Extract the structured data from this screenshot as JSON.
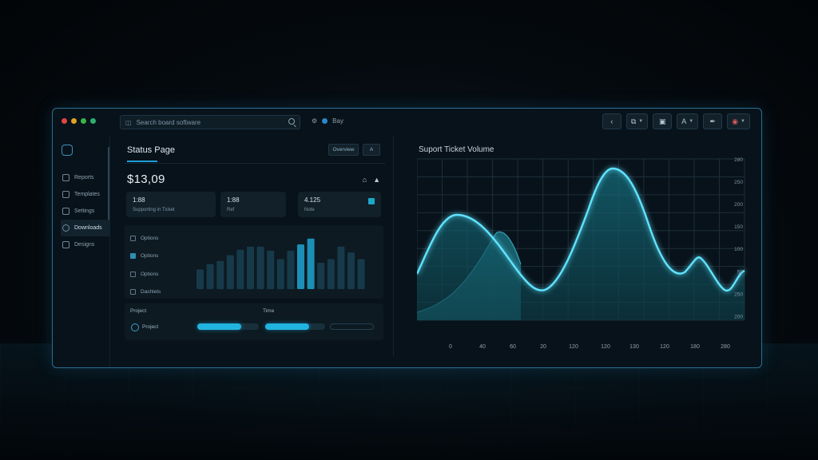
{
  "titlebar": {
    "search_placeholder": "Search board software",
    "location_label": "Bay"
  },
  "sidebar": {
    "items": [
      {
        "label": "Reports",
        "active": false
      },
      {
        "label": "Templates",
        "active": false
      },
      {
        "label": "Settings",
        "active": false
      },
      {
        "label": "Downloads",
        "active": true
      },
      {
        "label": "Designs",
        "active": false
      }
    ]
  },
  "main": {
    "title": "Status Page",
    "header_button_label": "Overview",
    "header_icon_label": "A",
    "big_value": "$13,09",
    "stats": [
      {
        "value": "1:88",
        "label": "Supporting in Ticket"
      },
      {
        "value": "1:88",
        "label": "Ref"
      },
      {
        "value": "4.125",
        "label": "Note"
      }
    ],
    "bar_legend": [
      "Options",
      "Options",
      "Options",
      "Dashlets"
    ],
    "bar_levels": [
      0.44,
      0.56,
      0.63,
      0.76,
      0.88,
      0.95,
      0.95,
      0.86,
      0.67,
      0.86,
      1.0,
      1.13,
      0.59,
      0.67,
      0.95,
      0.82,
      0.67
    ],
    "bar_highlight": [
      10,
      11
    ],
    "progress": {
      "headers": [
        "Project",
        "Time"
      ],
      "row_label": "Project",
      "values": [
        0.72,
        0.73,
        0.0
      ]
    }
  },
  "chart": {
    "title": "Suport Ticket Volume",
    "x_ticks": [
      "0",
      "40",
      "60",
      "20",
      "120",
      "120",
      "130",
      "120",
      "180",
      "280"
    ],
    "y_ticks": [
      "280",
      "250",
      "200",
      "150",
      "100",
      "50",
      "250",
      "200"
    ],
    "colors": {
      "line": "#5fe3ff",
      "fill": "#15707f",
      "grid": "#1c2f3a"
    }
  }
}
